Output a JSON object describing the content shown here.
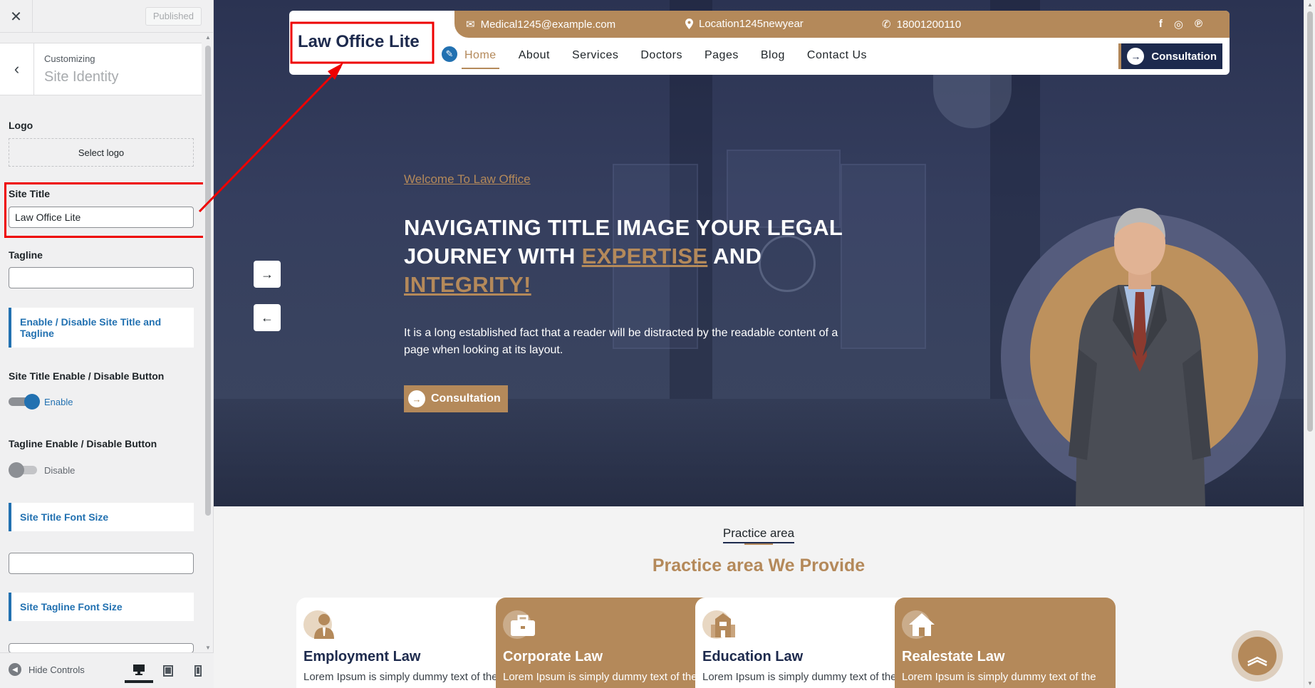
{
  "customizer": {
    "close_icon": "close-icon",
    "published_label": "Published",
    "breadcrumb": "Customizing",
    "section_title": "Site Identity",
    "logo_label": "Logo",
    "select_logo_label": "Select logo",
    "site_title_label": "Site Title",
    "site_title_value": "Law Office Lite",
    "tagline_label": "Tagline",
    "tagline_value": "",
    "enable_panel_label": "Enable / Disable Site Title and Tagline",
    "site_title_toggle_label": "Site Title Enable / Disable Button",
    "site_title_toggle_state": "Enable",
    "tagline_toggle_label": "Tagline Enable / Disable Button",
    "tagline_toggle_state": "Disable",
    "title_font_panel": "Site Title Font Size",
    "tagline_font_panel": "Site Tagline Font Size",
    "hide_controls_label": "Hide Controls",
    "devices": [
      "desktop",
      "tablet",
      "mobile"
    ],
    "active_device": "desktop"
  },
  "site": {
    "title": "Law Office Lite",
    "topbar": {
      "email": "Medical1245@example.com",
      "location": "Location1245newyear",
      "phone": "18001200110",
      "social": [
        "facebook",
        "instagram",
        "pinterest"
      ]
    },
    "nav": [
      "Home",
      "About",
      "Services",
      "Doctors",
      "Pages",
      "Blog",
      "Contact Us"
    ],
    "active_nav": "Home",
    "consultation_label": "Consultation"
  },
  "hero": {
    "welcome": "Welcome To Law Office",
    "heading_part1": "NAVIGATING TITLE IMAGE YOUR LEGAL JOURNEY WITH ",
    "heading_accent1": "EXPERTISE",
    "heading_part2": " AND ",
    "heading_accent2": "INTEGRITY!",
    "text": "It is a long established fact that a reader will be distracted by the readable content of a page when looking at its layout.",
    "cta_label": "Consultation"
  },
  "practice": {
    "eyebrow": "Practice area",
    "title": "Practice area We Provide",
    "cards": [
      {
        "title": "Employment Law",
        "text": "Lorem Ipsum is simply dummy text of the",
        "icon": "employee-icon",
        "style": "light"
      },
      {
        "title": "Corporate Law",
        "text": "Lorem Ipsum is simply dummy text of the",
        "icon": "briefcase-icon",
        "style": "brown"
      },
      {
        "title": "Education Law",
        "text": "Lorem Ipsum is simply dummy text of the",
        "icon": "school-icon",
        "style": "light"
      },
      {
        "title": "Realestate Law",
        "text": "Lorem Ipsum is simply dummy text of the",
        "icon": "house-icon",
        "style": "brown"
      }
    ]
  },
  "colors": {
    "accent": "#b4895a",
    "navy": "#1d2a4d",
    "wp_blue": "#2271b1",
    "annotation_red": "#ee0000"
  }
}
